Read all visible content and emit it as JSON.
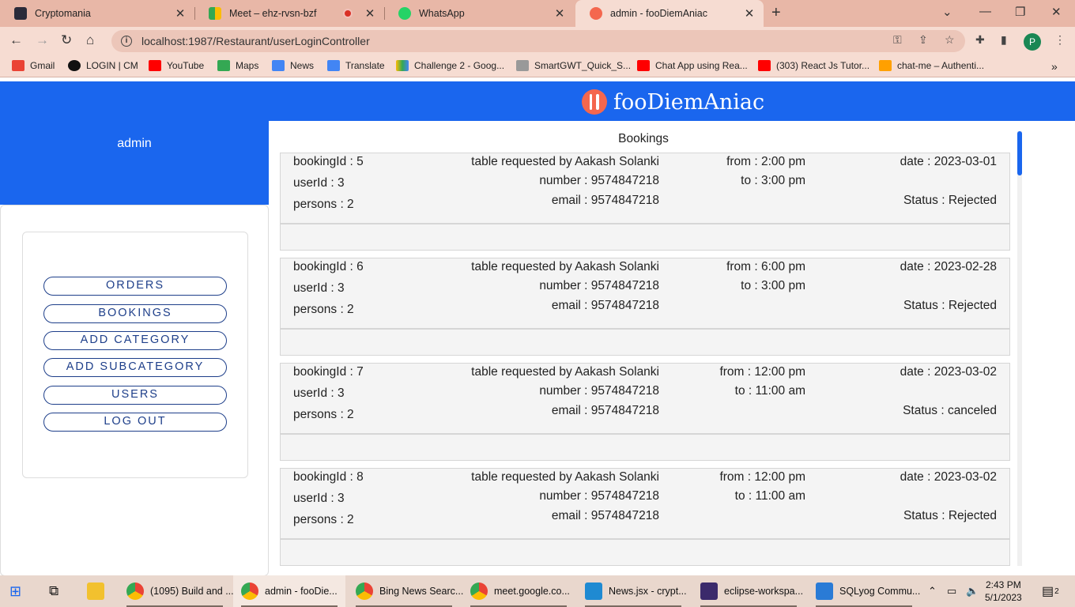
{
  "browser": {
    "tabs": [
      {
        "title": "Cryptomania",
        "active": false
      },
      {
        "title": "Meet – ehz-rvsn-bzf",
        "active": false,
        "recording": true
      },
      {
        "title": "WhatsApp",
        "active": false
      },
      {
        "title": "admin - fooDiemAniac",
        "active": true
      }
    ],
    "url": "localhost:1987/Restaurant/userLoginController",
    "profile_initial": "P",
    "bookmarks": [
      "Gmail",
      "LOGIN | CM",
      "YouTube",
      "Maps",
      "News",
      "Translate",
      "Challenge 2 - Goog...",
      "SmartGWT_Quick_S...",
      "Chat App using Rea...",
      "(303) React Js Tutor...",
      "chat-me – Authenti..."
    ]
  },
  "app": {
    "brand": "fooDiemAniac",
    "admin_name": "admin",
    "menu": [
      "ORDERS",
      "BOOKINGS",
      "ADD CATEGORY",
      "ADD SUBCATEGORY",
      "USERS",
      "LOG OUT"
    ],
    "section_title": "Bookings",
    "bookings": [
      {
        "id": "bookingId : 5",
        "user": "userId : 3",
        "persons": "persons : 2",
        "requested": "table requested by Aakash Solanki",
        "number": "number : 9574847218",
        "email": "email : 9574847218",
        "from": "from : 2:00 pm",
        "to": "to : 3:00 pm",
        "date": "date : 2023-03-01",
        "status": "Status : Rejected"
      },
      {
        "id": "bookingId : 6",
        "user": "userId : 3",
        "persons": "persons : 2",
        "requested": "table requested by Aakash Solanki",
        "number": "number : 9574847218",
        "email": "email : 9574847218",
        "from": "from : 6:00 pm",
        "to": "to : 3:00 pm",
        "date": "date : 2023-02-28",
        "status": "Status : Rejected"
      },
      {
        "id": "bookingId : 7",
        "user": "userId : 3",
        "persons": "persons : 2",
        "requested": "table requested by Aakash Solanki",
        "number": "number : 9574847218",
        "email": "email : 9574847218",
        "from": "from : 12:00 pm",
        "to": "to : 11:00 am",
        "date": "date : 2023-03-02",
        "status": "Status : canceled"
      },
      {
        "id": "bookingId : 8",
        "user": "userId : 3",
        "persons": "persons : 2",
        "requested": "table requested by Aakash Solanki",
        "number": "number : 9574847218",
        "email": "email : 9574847218",
        "from": "from : 12:00 pm",
        "to": "to : 11:00 am",
        "date": "date : 2023-03-02",
        "status": "Status : Rejected"
      }
    ]
  },
  "taskbar": {
    "items": [
      "(1095) Build and ...",
      "admin - fooDie...",
      "Bing News Searc...",
      "meet.google.co...",
      "News.jsx - crypt...",
      "eclipse-workspa...",
      "SQLyog Commu..."
    ],
    "time": "2:43 PM",
    "date": "5/1/2023",
    "notifications": "2"
  },
  "colors": {
    "accent": "#1a66ee",
    "menu_border": "#1e3f8a",
    "tabstrip": "#e8b7a7"
  }
}
